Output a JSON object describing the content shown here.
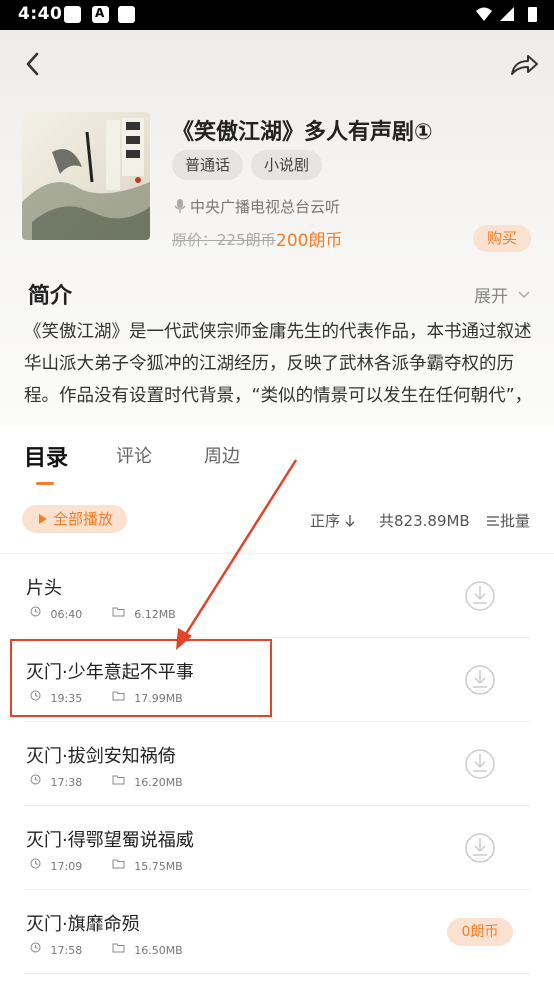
{
  "status_bar": {
    "time": "4:40"
  },
  "book": {
    "title": "《笑傲江湖》多人有声剧①",
    "tags": [
      "普通话",
      "小说剧"
    ],
    "publisher": "中央广播电视总台云听",
    "original_price": "原价：225朗币",
    "price": "200朗币",
    "buy_label": "购买"
  },
  "intro": {
    "title": "简介",
    "expand_label": "展开",
    "text": "《笑傲江湖》是一代武侠宗师金庸先生的代表作品，本书通过叙述华山派大弟子令狐冲的江湖经历，反映了武林各派争霸夺权的历程。作品没有设置时代背景，“类似的情景可以发生在任何朝代”，"
  },
  "tabs": [
    "目录",
    "评论",
    "周边"
  ],
  "toolbar": {
    "play_all": "全部播放",
    "sort": "正序",
    "total": "共823.89MB",
    "batch": "批量"
  },
  "episodes": [
    {
      "name": "片头",
      "duration": "06:40",
      "size": "6.12MB",
      "action": "download"
    },
    {
      "name": "灭门·少年意起不平事",
      "duration": "19:35",
      "size": "17.99MB",
      "action": "download"
    },
    {
      "name": "灭门·拔剑安知祸倚",
      "duration": "17:38",
      "size": "16.20MB",
      "action": "download"
    },
    {
      "name": "灭门·得鄂望蜀说福威",
      "duration": "17:09",
      "size": "15.75MB",
      "action": "download"
    },
    {
      "name": "灭门·旗靡命殒",
      "duration": "17:58",
      "size": "16.50MB",
      "action": "coin",
      "coin_label": "0朗币"
    }
  ],
  "colors": {
    "accent": "#f07e2a",
    "annotation": "#e2442a"
  }
}
